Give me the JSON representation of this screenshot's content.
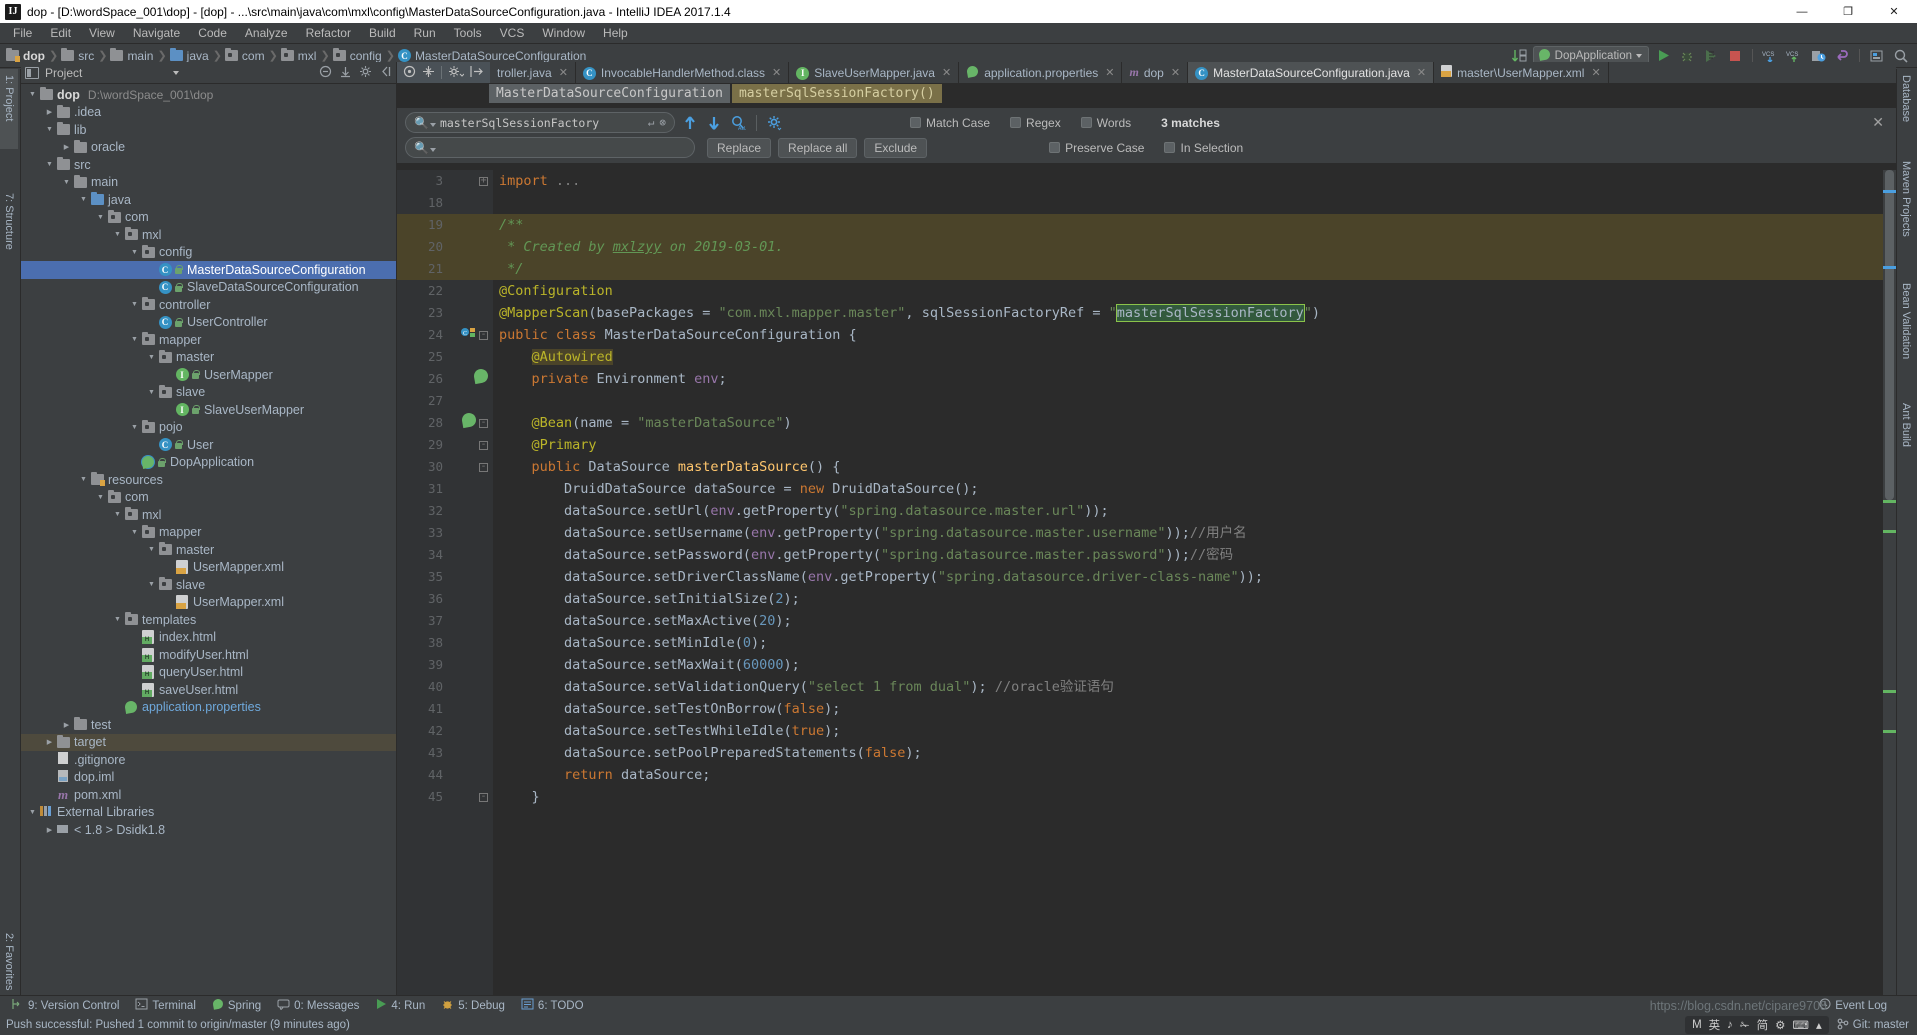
{
  "window": {
    "title": "dop - [D:\\wordSpace_001\\dop] - [dop] - ...\\src\\main\\java\\com\\mxl\\config\\MasterDataSourceConfiguration.java - IntelliJ IDEA 2017.1.4",
    "logo": "IJ",
    "minimize": "—",
    "maximize": "❐",
    "close": "✕"
  },
  "menubar": {
    "items": [
      "File",
      "Edit",
      "View",
      "Navigate",
      "Code",
      "Analyze",
      "Refactor",
      "Build",
      "Run",
      "Tools",
      "VCS",
      "Window",
      "Help"
    ]
  },
  "navbar": {
    "crumbs": [
      {
        "label": "dop",
        "icon": "folder-icon",
        "bold": true
      },
      {
        "label": "src",
        "icon": "folder-icon"
      },
      {
        "label": "main",
        "icon": "folder-icon"
      },
      {
        "label": "java",
        "icon": "folder-blue-icon"
      },
      {
        "label": "com",
        "icon": "package-icon"
      },
      {
        "label": "mxl",
        "icon": "package-icon"
      },
      {
        "label": "config",
        "icon": "package-icon"
      },
      {
        "label": "MasterDataSourceConfiguration",
        "icon": "class-icon",
        "active": true
      }
    ],
    "run_config": "DopApplication",
    "right_icons": [
      "sort-icon",
      "run-icon",
      "debug-icon",
      "coverage-icon",
      "stop-icon",
      "vcs-update-icon",
      "vcs-commit-icon",
      "history-icon",
      "undo-icon",
      "settings-icon",
      "search-everywhere-icon"
    ]
  },
  "left_strip": {
    "project_tab": "1: Project",
    "structure_tab": "7: Structure"
  },
  "right_strip": {
    "tabs": [
      "Database",
      "Maven Projects",
      "Bean Validation",
      "Ant Build"
    ]
  },
  "project_panel": {
    "title": "Project",
    "tree": [
      {
        "depth": 0,
        "arrow": "down",
        "icon": "folder-icon",
        "label": "dop",
        "sub": "D:\\wordSpace_001\\dop",
        "bold": true
      },
      {
        "depth": 1,
        "arrow": "right",
        "icon": "folder-icon",
        "label": ".idea"
      },
      {
        "depth": 1,
        "arrow": "down",
        "icon": "folder-icon",
        "label": "lib"
      },
      {
        "depth": 2,
        "arrow": "right",
        "icon": "folder-icon",
        "label": "oracle"
      },
      {
        "depth": 1,
        "arrow": "down",
        "icon": "folder-icon",
        "label": "src"
      },
      {
        "depth": 2,
        "arrow": "down",
        "icon": "folder-icon",
        "label": "main"
      },
      {
        "depth": 3,
        "arrow": "down",
        "icon": "folder-blue-icon",
        "label": "java"
      },
      {
        "depth": 4,
        "arrow": "down",
        "icon": "package-icon",
        "label": "com"
      },
      {
        "depth": 5,
        "arrow": "down",
        "icon": "package-icon",
        "label": "mxl"
      },
      {
        "depth": 6,
        "arrow": "down",
        "icon": "package-icon",
        "label": "config"
      },
      {
        "depth": 7,
        "arrow": "",
        "icon": "class-icon",
        "lock": true,
        "label": "MasterDataSourceConfiguration",
        "selected": true
      },
      {
        "depth": 7,
        "arrow": "",
        "icon": "class-icon",
        "lock": true,
        "label": "SlaveDataSourceConfiguration"
      },
      {
        "depth": 6,
        "arrow": "down",
        "icon": "package-icon",
        "label": "controller"
      },
      {
        "depth": 7,
        "arrow": "",
        "icon": "class-icon",
        "lock": true,
        "label": "UserController"
      },
      {
        "depth": 6,
        "arrow": "down",
        "icon": "package-icon",
        "label": "mapper"
      },
      {
        "depth": 7,
        "arrow": "down",
        "icon": "package-icon",
        "label": "master"
      },
      {
        "depth": 8,
        "arrow": "",
        "icon": "interface-icon",
        "lock": true,
        "label": "UserMapper"
      },
      {
        "depth": 7,
        "arrow": "down",
        "icon": "package-icon",
        "label": "slave"
      },
      {
        "depth": 8,
        "arrow": "",
        "icon": "interface-icon",
        "lock": true,
        "label": "SlaveUserMapper"
      },
      {
        "depth": 6,
        "arrow": "down",
        "icon": "package-icon",
        "label": "pojo"
      },
      {
        "depth": 7,
        "arrow": "",
        "icon": "class-icon",
        "lock": true,
        "label": "User"
      },
      {
        "depth": 6,
        "arrow": "",
        "icon": "spring-boot-icon",
        "lock": true,
        "label": "DopApplication"
      },
      {
        "depth": 3,
        "arrow": "down",
        "icon": "resources-folder-icon",
        "label": "resources"
      },
      {
        "depth": 4,
        "arrow": "down",
        "icon": "package-icon",
        "label": "com"
      },
      {
        "depth": 5,
        "arrow": "down",
        "icon": "package-icon",
        "label": "mxl"
      },
      {
        "depth": 6,
        "arrow": "down",
        "icon": "package-icon",
        "label": "mapper"
      },
      {
        "depth": 7,
        "arrow": "down",
        "icon": "package-icon",
        "label": "master"
      },
      {
        "depth": 8,
        "arrow": "",
        "icon": "xml-icon",
        "label": "UserMapper.xml"
      },
      {
        "depth": 7,
        "arrow": "down",
        "icon": "package-icon",
        "label": "slave"
      },
      {
        "depth": 8,
        "arrow": "",
        "icon": "xml-icon",
        "label": "UserMapper.xml"
      },
      {
        "depth": 5,
        "arrow": "down",
        "icon": "package-icon",
        "label": "templates"
      },
      {
        "depth": 6,
        "arrow": "",
        "icon": "html-icon",
        "label": "index.html"
      },
      {
        "depth": 6,
        "arrow": "",
        "icon": "html-icon",
        "label": "modifyUser.html"
      },
      {
        "depth": 6,
        "arrow": "",
        "icon": "html-icon",
        "label": "queryUser.html"
      },
      {
        "depth": 6,
        "arrow": "",
        "icon": "html-icon",
        "label": "saveUser.html"
      },
      {
        "depth": 5,
        "arrow": "",
        "icon": "spring-icon",
        "label": "application.properties",
        "link": true
      },
      {
        "depth": 2,
        "arrow": "right",
        "icon": "folder-icon",
        "label": "test"
      },
      {
        "depth": 1,
        "arrow": "right",
        "icon": "folder-icon",
        "label": "target",
        "highlight": true
      },
      {
        "depth": 1,
        "arrow": "",
        "icon": "file-icon",
        "label": ".gitignore"
      },
      {
        "depth": 1,
        "arrow": "",
        "icon": "iml-icon",
        "label": "dop.iml"
      },
      {
        "depth": 1,
        "arrow": "",
        "icon": "maven-icon",
        "label": "pom.xml"
      },
      {
        "depth": 0,
        "arrow": "down",
        "icon": "library-icon",
        "label": "External Libraries"
      },
      {
        "depth": 1,
        "arrow": "right",
        "icon": "jdk-icon",
        "label": "< 1.8 > Dsidk1.8"
      }
    ]
  },
  "editor": {
    "tabs": [
      {
        "label": "troller.java",
        "icon": "class-icon",
        "closable": true,
        "truncated": true
      },
      {
        "label": "InvocableHandlerMethod.class",
        "icon": "class-icon",
        "closable": true
      },
      {
        "label": "SlaveUserMapper.java",
        "icon": "interface-icon",
        "closable": true
      },
      {
        "label": "application.properties",
        "icon": "spring-icon",
        "closable": true
      },
      {
        "label": "dop",
        "icon": "maven-icon",
        "closable": true
      },
      {
        "label": "MasterDataSourceConfiguration.java",
        "icon": "class-icon",
        "closable": true,
        "active": true
      },
      {
        "label": "master\\UserMapper.xml",
        "icon": "xml-icon",
        "closable": true
      }
    ],
    "code_breadcrumbs": [
      {
        "label": "MasterDataSourceConfiguration",
        "highlight": false
      },
      {
        "label": "masterSqlSessionFactory()",
        "highlight": true
      }
    ]
  },
  "find_panel": {
    "search_value": "masterSqlSessionFactory",
    "search_placeholder": "",
    "replace_value": "",
    "replace_placeholder": "",
    "buttons": {
      "replace": "Replace",
      "replace_all": "Replace all",
      "exclude": "Exclude"
    },
    "options": [
      {
        "label": "Match Case",
        "checked": false
      },
      {
        "label": "Regex",
        "checked": false
      },
      {
        "label": "Words",
        "checked": false
      }
    ],
    "options2": [
      {
        "label": "Preserve Case",
        "checked": false
      },
      {
        "label": "In Selection",
        "checked": false
      }
    ],
    "matches": "3 matches",
    "close": "✕"
  },
  "code": {
    "lines": [
      {
        "num": "3",
        "fold": "+",
        "html": "<span class='kw'>import</span> <span class='cmt'>...</span>"
      },
      {
        "num": "18",
        "html": ""
      },
      {
        "num": "19",
        "hi": true,
        "html": "<span class='jdoc'>/**</span>"
      },
      {
        "num": "20",
        "hi": true,
        "html": "<span class='jdoc'> * Created by <u>mxlzyy</u> on 2019-03-01.</span>"
      },
      {
        "num": "21",
        "hi": true,
        "html": "<span class='jdoc'> */</span>"
      },
      {
        "num": "22",
        "html": "<span class='ann'>@Configuration</span>"
      },
      {
        "num": "23",
        "html": "<span class='ann'>@MapperScan</span>(<span class='cn'>basePackages</span> = <span class='str'>\"com.mxl.mapper.master\"</span>, <span class='cn'>sqlSessionFactoryRef</span> = <span class='str'>\"</span><span class='hlbox'>masterSqlSessionFactory</span><span class='str'>\"</span>)"
      },
      {
        "num": "24",
        "fold": "-",
        "mark": "class",
        "html": "<span class='kw'>public class</span> MasterDataSourceConfiguration {"
      },
      {
        "num": "25",
        "html": "    <span class='ann ann-bg'>@Autowired</span>"
      },
      {
        "num": "26",
        "mark": "bean",
        "html": "    <span class='kw'>private</span> Environment <span class='fld'>env</span>;"
      },
      {
        "num": "27",
        "html": ""
      },
      {
        "num": "28",
        "mark": "bean",
        "fold": "-",
        "html": "    <span class='ann'>@Bean</span>(<span class='cn'>name</span> = <span class='str'>\"masterDataSource\"</span>)"
      },
      {
        "num": "29",
        "fold": "-",
        "html": "    <span class='ann'>@Primary</span>"
      },
      {
        "num": "30",
        "fold": "-",
        "html": "    <span class='kw'>public</span> DataSource <span class='fn'>masterDataSource</span>() {"
      },
      {
        "num": "31",
        "html": "        DruidDataSource dataSource = <span class='kw'>new</span> DruidDataSource();"
      },
      {
        "num": "32",
        "html": "        dataSource.setUrl(<span class='fld'>env</span>.getProperty(<span class='str'>\"spring.datasource.master.url\"</span>));"
      },
      {
        "num": "33",
        "html": "        dataSource.setUsername(<span class='fld'>env</span>.getProperty(<span class='str'>\"spring.datasource.master.username\"</span>));<span class='cmt'>//用户名</span>"
      },
      {
        "num": "34",
        "html": "        dataSource.setPassword(<span class='fld'>env</span>.getProperty(<span class='str'>\"spring.datasource.master.password\"</span>));<span class='cmt'>//密码</span>"
      },
      {
        "num": "35",
        "html": "        dataSource.setDriverClassName(<span class='fld'>env</span>.getProperty(<span class='str'>\"spring.datasource.driver-class-name\"</span>));"
      },
      {
        "num": "36",
        "html": "        dataSource.setInitialSize(<span class='num'>2</span>);"
      },
      {
        "num": "37",
        "html": "        dataSource.setMaxActive(<span class='num'>20</span>);"
      },
      {
        "num": "38",
        "html": "        dataSource.setMinIdle(<span class='num'>0</span>);"
      },
      {
        "num": "39",
        "html": "        dataSource.setMaxWait(<span class='num'>60000</span>);"
      },
      {
        "num": "40",
        "html": "        dataSource.setValidationQuery(<span class='str'>\"select 1 from dual\"</span>); <span class='cmt'>//oracle验证语句</span>"
      },
      {
        "num": "41",
        "html": "        dataSource.setTestOnBorrow(<span class='kw'>false</span>);"
      },
      {
        "num": "42",
        "html": "        dataSource.setTestWhileIdle(<span class='kw'>true</span>);"
      },
      {
        "num": "43",
        "html": "        dataSource.setPoolPreparedStatements(<span class='kw'>false</span>);"
      },
      {
        "num": "44",
        "html": "        <span class='kw'>return</span> dataSource;"
      },
      {
        "num": "45",
        "fold": "-",
        "html": "    }"
      }
    ]
  },
  "bottom_bar": {
    "items": [
      {
        "label": "9: Version Control",
        "icon": "vcs-icon"
      },
      {
        "label": "Terminal",
        "icon": "terminal-icon"
      },
      {
        "label": "Spring",
        "icon": "spring-icon"
      },
      {
        "label": "0: Messages",
        "icon": "messages-icon"
      },
      {
        "label": "4: Run",
        "icon": "run-icon"
      },
      {
        "label": "5: Debug",
        "icon": "debug-icon"
      },
      {
        "label": "6: TODO",
        "icon": "todo-icon"
      }
    ],
    "event_log": "Event Log"
  },
  "status_bar": {
    "message": "Push successful: Pushed 1 commit to origin/master (9 minutes ago)",
    "git_branch": "Git: master",
    "ime": [
      "M",
      "英",
      "♪",
      "✁",
      "简",
      "⚙",
      "⌨",
      "▴"
    ]
  },
  "watermark": "https://blog.csdn.net/cipare9708",
  "colors": {
    "accent": "#4b6eaf",
    "editor_bg": "#2b2b2b",
    "panel_bg": "#3c3f41",
    "text": "#a9b7c6",
    "string": "#6a8759",
    "keyword": "#cc7832",
    "annotation": "#bbb529",
    "number": "#6897bb",
    "match_highlight": "#32593d"
  }
}
